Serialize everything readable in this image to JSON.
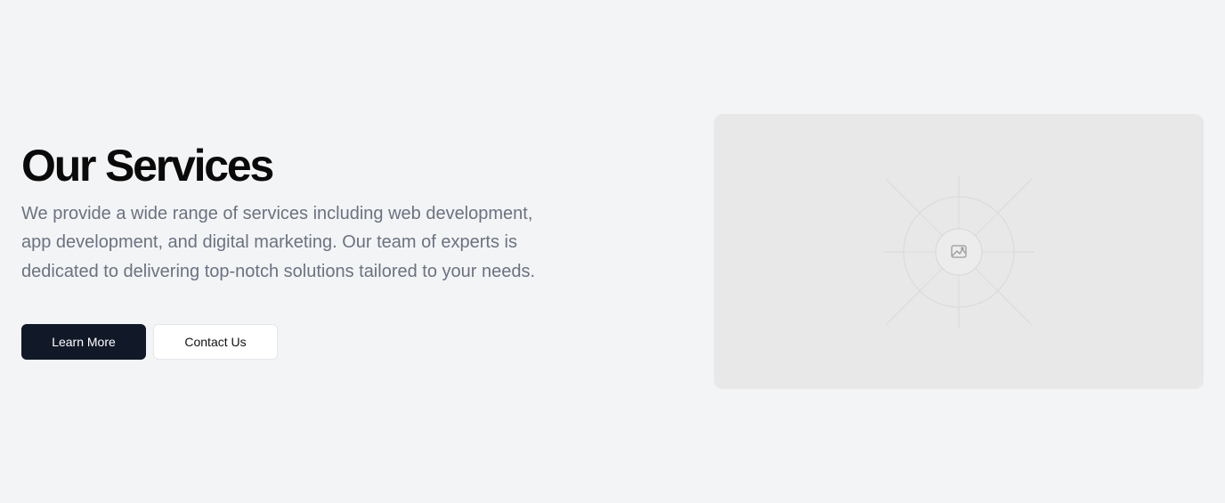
{
  "section": {
    "title": "Our Services",
    "description": "We provide a wide range of services including web development, app development, and digital marketing. Our team of experts is dedicated to delivering top-notch solutions tailored to your needs.",
    "buttons": {
      "primary_label": "Learn More",
      "secondary_label": "Contact Us"
    }
  },
  "image": {
    "icon": "image-placeholder-icon"
  },
  "colors": {
    "background": "#f3f4f6",
    "primary_button": "#111827",
    "text_muted": "#6b7280",
    "placeholder_bg": "#e8e8e8"
  }
}
